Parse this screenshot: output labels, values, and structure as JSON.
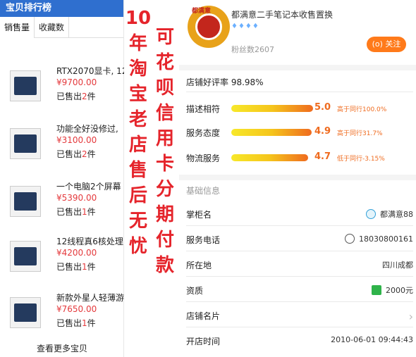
{
  "left_panel": {
    "title": "宝贝排行榜",
    "tabs": [
      "销售量",
      "收藏数"
    ],
    "items": [
      {
        "title": "RTX2070显卡, 12",
        "price": "¥9700.00",
        "sold_prefix": "已售出",
        "sold_count": "2",
        "sold_suffix": "件"
      },
      {
        "title": "功能全好没修过,",
        "price": "¥3100.00",
        "sold_prefix": "已售出",
        "sold_count": "2",
        "sold_suffix": "件"
      },
      {
        "title": "一个电脑2个屏幕",
        "price": "¥5390.00",
        "sold_prefix": "已售出",
        "sold_count": "1",
        "sold_suffix": "件"
      },
      {
        "title": "12线程真6核处理",
        "price": "¥4200.00",
        "sold_prefix": "已售出",
        "sold_count": "1",
        "sold_suffix": "件"
      },
      {
        "title": "新款外星人轻薄游",
        "price": "¥7650.00",
        "sold_prefix": "已售出",
        "sold_count": "1",
        "sold_suffix": "件"
      }
    ],
    "more_label": "查看更多宝贝"
  },
  "overlay": {
    "col1": [
      "10",
      "年",
      "淘",
      "宝",
      "老",
      "店",
      "售",
      "后",
      "无",
      "忧"
    ],
    "col2": [
      "可",
      "花",
      "呗",
      "信",
      "用",
      "卡",
      "分",
      "期",
      "付",
      "款"
    ]
  },
  "shop": {
    "logo_text": "都满意",
    "name": "都满意二手笔记本收售置换",
    "diamonds": "♦♦♦♦",
    "fans": "粉丝数2607",
    "follow_label": "(o) 关注",
    "good_rate": "店铺好评率 98.98%",
    "metrics": [
      {
        "label": "描述相符",
        "score": "5.0",
        "compare": "高于同行100.0%",
        "fill": 1.0
      },
      {
        "label": "服务态度",
        "score": "4.9",
        "compare": "高于同行31.7%",
        "fill": 0.98
      },
      {
        "label": "物流服务",
        "score": "4.7",
        "compare": "低于同行-3.15%",
        "fill": 0.94
      }
    ],
    "basic_title": "基础信息",
    "info": [
      {
        "label": "掌柜名",
        "value": "都满意88",
        "icon": "chat-icon"
      },
      {
        "label": "服务电话",
        "value": "18030800161",
        "icon": "phone-icon"
      },
      {
        "label": "所在地",
        "value": "四川成都",
        "icon": ""
      },
      {
        "label": "资质",
        "value": "2000元",
        "icon": "deposit-icon"
      },
      {
        "label": "店铺名片",
        "value": "",
        "icon": "chevron-right-icon"
      },
      {
        "label": "开店时间",
        "value": "2010-06-01 09:44:43",
        "icon": ""
      }
    ]
  },
  "colors": {
    "accent": "#e5242b",
    "header": "#2f6fcf",
    "score": "#ef6b1f",
    "follow": "#ff7a1a"
  }
}
